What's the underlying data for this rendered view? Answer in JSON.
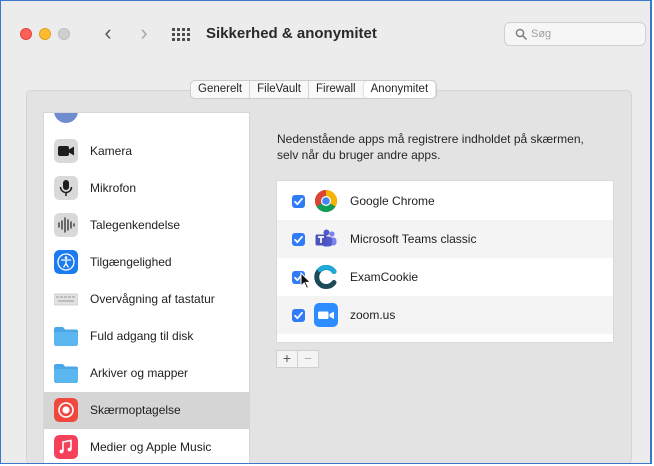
{
  "window": {
    "title": "Sikkerhed & anonymitet",
    "search_placeholder": "Søg"
  },
  "toolbar": {
    "back_label": "‹",
    "forward_label": "›"
  },
  "tabs": [
    {
      "label": "Generelt",
      "selected": false
    },
    {
      "label": "FileVault",
      "selected": false
    },
    {
      "label": "Firewall",
      "selected": false
    },
    {
      "label": "Anonymitet",
      "selected": true
    }
  ],
  "sidebar": {
    "items": [
      {
        "label": "Kamera",
        "icon": "camera-icon"
      },
      {
        "label": "Mikrofon",
        "icon": "microphone-icon"
      },
      {
        "label": "Talegenkendelse",
        "icon": "speech-recognition-icon"
      },
      {
        "label": "Tilgængelighed",
        "icon": "accessibility-icon"
      },
      {
        "label": "Overvågning af tastatur",
        "icon": "keyboard-icon"
      },
      {
        "label": "Fuld adgang til disk",
        "icon": "folder-icon"
      },
      {
        "label": "Arkiver og mapper",
        "icon": "folder-icon"
      },
      {
        "label": "Skærmoptagelse",
        "icon": "screen-recording-icon",
        "selected": true
      },
      {
        "label": "Medier og Apple Music",
        "icon": "music-icon"
      }
    ]
  },
  "main": {
    "description_line1": "Nedenstående apps må registrere indholdet på skærmen,",
    "description_line2": "selv når du bruger andre apps.",
    "apps": [
      {
        "label": "Google Chrome",
        "icon": "chrome-icon",
        "checked": true
      },
      {
        "label": "Microsoft Teams classic",
        "icon": "teams-icon",
        "checked": true
      },
      {
        "label": "ExamCookie",
        "icon": "examcookie-icon",
        "checked": true
      },
      {
        "label": "zoom.us",
        "icon": "zoom-icon",
        "checked": true
      }
    ],
    "add_label": "+",
    "remove_label": "−"
  },
  "colors": {
    "accent": "#2f7cf6",
    "selection": "#d5d5d5",
    "window_border": "#3a79c9"
  }
}
